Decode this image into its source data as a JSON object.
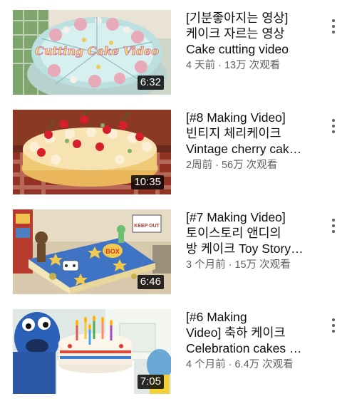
{
  "videos": [
    {
      "title_lines": [
        "[기분좋아지는 영상]",
        "케이크 자르는 영상",
        "Cake cutting video"
      ],
      "age": "4 天前",
      "views": "13万 次观看",
      "duration": "6:32",
      "thumb_text": "Cutting Cake Video"
    },
    {
      "title_lines": [
        "[#8 Making Video]",
        "빈티지 체리케이크",
        "Vintage cherry cak…"
      ],
      "age": "2周前",
      "views": "56万 次观看",
      "duration": "10:35"
    },
    {
      "title_lines": [
        "[#7 Making Video]",
        "토이스토리 앤디의",
        "방 케이크 Toy Story…"
      ],
      "age": "3 个月前",
      "views": "15万 次观看",
      "duration": "6:46",
      "thumb_text": "KEEP OUT"
    },
    {
      "title_lines": [
        "[#6 Making",
        "Video] 축하 케이크",
        "Celebration cakes …"
      ],
      "age": "4 个月前",
      "views": "6.4万 次观看",
      "duration": "7:05"
    }
  ],
  "separator": " · ",
  "more_icon": "more-vert-icon"
}
